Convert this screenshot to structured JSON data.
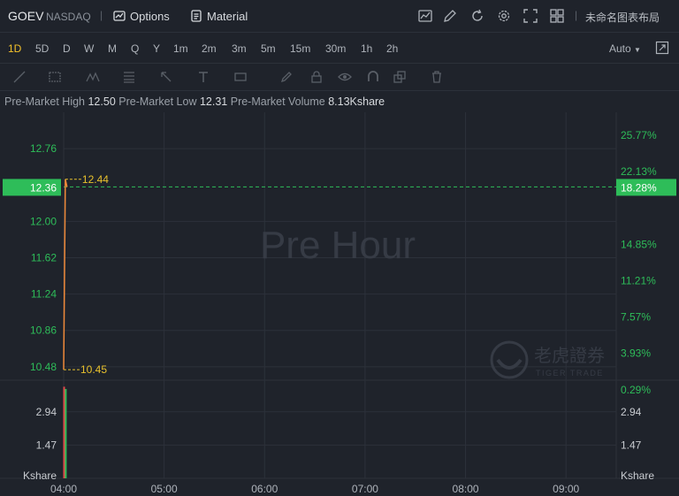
{
  "header": {
    "symbol": "GOEV",
    "exchange": "NASDAQ",
    "separator": "|",
    "options_label": "Options",
    "material_label": "Material",
    "layout_name": "未命名图表布局"
  },
  "periods": [
    {
      "label": "1D",
      "active": true
    },
    {
      "label": "5D",
      "active": false
    },
    {
      "label": "D",
      "active": false
    },
    {
      "label": "W",
      "active": false
    },
    {
      "label": "M",
      "active": false
    },
    {
      "label": "Q",
      "active": false
    },
    {
      "label": "Y",
      "active": false
    },
    {
      "label": "1m",
      "active": false
    },
    {
      "label": "2m",
      "active": false
    },
    {
      "label": "3m",
      "active": false
    },
    {
      "label": "5m",
      "active": false
    },
    {
      "label": "15m",
      "active": false
    },
    {
      "label": "30m",
      "active": false
    },
    {
      "label": "1h",
      "active": false
    },
    {
      "label": "2h",
      "active": false
    }
  ],
  "auto_label": "Auto",
  "info": {
    "high_label": "Pre-Market High",
    "high_value": "12.50",
    "low_label": "Pre-Market Low",
    "low_value": "12.31",
    "volume_label": "Pre-Market Volume",
    "volume_value": "8.13Kshare"
  },
  "colors": {
    "price_line": "#f08a3a",
    "up": "#2ebd59",
    "down": "#e04a4a",
    "marker": "#e8c12c",
    "badge": "#2ebd59",
    "grid": "#2c313a"
  },
  "chart_data": {
    "type": "line",
    "title": "",
    "watermark": "Pre Hour",
    "x_tick_labels": [
      "04:00",
      "05:00",
      "06:00",
      "07:00",
      "08:00",
      "09:00"
    ],
    "x_tick_minutes": [
      0,
      60,
      120,
      180,
      240,
      300
    ],
    "x_range_minutes": [
      0,
      330
    ],
    "price": {
      "tick_labels": [
        "12.76",
        "12.00",
        "11.62",
        "11.24",
        "10.86",
        "10.48"
      ],
      "tick_values": [
        12.76,
        12.0,
        11.62,
        11.24,
        10.86,
        10.48
      ],
      "range": [
        10.34,
        13.14
      ],
      "current": "12.36",
      "current_value": 12.36,
      "high_marker": "12.44",
      "high_value": 12.44,
      "low_marker": "10.45",
      "low_value": 10.45,
      "series": [
        {
          "t": 0,
          "p": 10.45
        },
        {
          "t": 1,
          "p": 12.44
        },
        {
          "t": 2,
          "p": 12.36
        }
      ]
    },
    "percent_axis": {
      "tick_labels": [
        "25.77%",
        "22.13%",
        "14.85%",
        "11.21%",
        "7.57%",
        "3.93%",
        "0.29%"
      ],
      "tick_values": [
        12.9,
        12.52,
        11.76,
        11.38,
        11.0,
        10.62,
        10.24
      ],
      "current": "18.28%"
    },
    "volume": {
      "unit": "Kshare",
      "tick_labels": [
        "2.94",
        "1.47"
      ],
      "tick_values": [
        2.94,
        1.47
      ],
      "range": [
        0,
        4.3
      ],
      "bars": [
        {
          "t": 0,
          "v": 4.05,
          "up": false
        },
        {
          "t": 1,
          "v": 3.95,
          "up": true
        }
      ]
    }
  },
  "brand": {
    "name": "老虎證券",
    "sub": "TIGER TRADE"
  }
}
